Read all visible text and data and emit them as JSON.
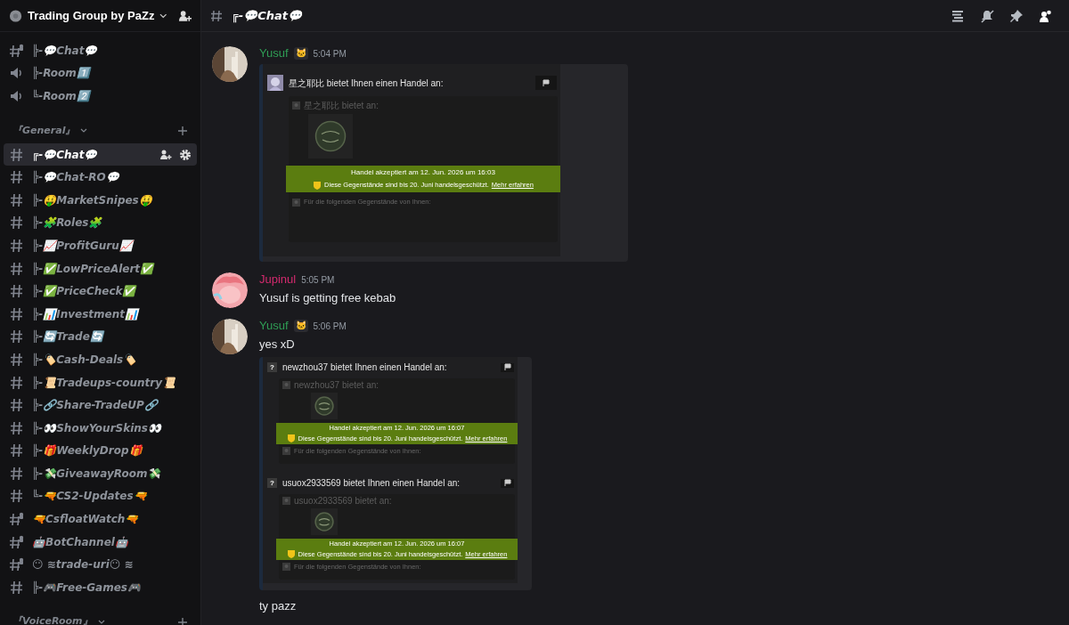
{
  "server": {
    "name": "Trading Group by PaZz"
  },
  "channels": [
    {
      "kind": "locked",
      "name": "╠-💬Chat💬",
      "selected": false
    },
    {
      "kind": "voice",
      "name": "╠-Room1️⃣",
      "selected": false
    },
    {
      "kind": "voice",
      "name": "╚-Room2️⃣",
      "selected": false
    }
  ],
  "categories": [
    {
      "name": "『General』",
      "channels": [
        {
          "kind": "text",
          "name": "╔-💬Chat💬",
          "selected": true
        },
        {
          "kind": "text",
          "name": "╠-💬Chat-RO💬",
          "selected": false
        },
        {
          "kind": "text",
          "name": "╠-🤑MarketSnipes🤑",
          "selected": false
        },
        {
          "kind": "text",
          "name": "╠-🧩Roles🧩",
          "selected": false
        },
        {
          "kind": "text",
          "name": "╠-📈ProfitGuru📈",
          "selected": false
        },
        {
          "kind": "text",
          "name": "╠-✅LowPriceAlert✅",
          "selected": false
        },
        {
          "kind": "text",
          "name": "╠-✅PriceCheck✅",
          "selected": false
        },
        {
          "kind": "text",
          "name": "╠-📊Investment📊",
          "selected": false
        },
        {
          "kind": "text",
          "name": "╠-🔄Trade🔄",
          "selected": false
        },
        {
          "kind": "text",
          "name": "╠-🏷️Cash-Deals🏷️",
          "selected": false
        },
        {
          "kind": "text",
          "name": "╠-📜Tradeups-country📜",
          "selected": false
        },
        {
          "kind": "text",
          "name": "╠-🔗Share-TradeUP🔗",
          "selected": false
        },
        {
          "kind": "text",
          "name": "╠-👀ShowYourSkins👀",
          "selected": false
        },
        {
          "kind": "text",
          "name": "╠-🎁WeeklyDrop🎁",
          "selected": false
        },
        {
          "kind": "text",
          "name": "╠-💸GiveawayRoom💸",
          "selected": false
        },
        {
          "kind": "text",
          "name": "╚-🔫CS2-Updates🔫",
          "selected": false
        },
        {
          "kind": "locked",
          "name": "🔫CsfloatWatch🔫",
          "selected": false
        },
        {
          "kind": "locked",
          "name": "🤖BotChannel🤖",
          "selected": false
        },
        {
          "kind": "locked",
          "name": "😶 ≋trade-uri😶 ≋",
          "selected": false
        },
        {
          "kind": "text",
          "name": "╠-🎮Free-Games🎮",
          "selected": false
        }
      ]
    },
    {
      "name": "『VoiceRoom』"
    }
  ],
  "header": {
    "channel": "╔-💬Chat💬"
  },
  "messages": [
    {
      "author": "Yusuf",
      "color": "#2f9e55",
      "badge": "🐱",
      "time": "5:04 PM",
      "attachment": {
        "trades": [
          {
            "title": "星之耶比 bietet Ihnen einen Handel an:",
            "offer": "星之耶比 bietet an:",
            "accepted": "Handel akzeptiert am 12. Jun. 2026 um 16:03",
            "protected": "Diese Gegenstände sind bis 20. Juni handelsgeschützt.",
            "link": "Mehr erfahren",
            "yours": "Für die folgenden Gegenstände von Ihnen:"
          }
        ]
      }
    },
    {
      "author": "Jupinul",
      "color": "#d42a6e",
      "time": "5:05 PM",
      "text": "Yusuf is getting free kebab"
    },
    {
      "author": "Yusuf",
      "color": "#2f9e55",
      "badge": "🐱",
      "time": "5:06 PM",
      "text": "yes xD",
      "attachment": {
        "trades": [
          {
            "avatar": {
              "kind": "unknown",
              "text": "?"
            },
            "title": "newzhou37 bietet Ihnen einen Handel an:",
            "offer": "newzhou37 bietet an:",
            "accepted": "Handel akzeptiert am 12. Jun. 2026 um 16:07",
            "protected": "Diese Gegenstände sind bis 20. Juni handelsgeschützt.",
            "link": "Mehr erfahren",
            "yours": "Für die folgenden Gegenstände von Ihnen:"
          },
          {
            "avatar": {
              "kind": "unknown",
              "text": "?"
            },
            "title": "usuox2933569 bietet Ihnen einen Handel an:",
            "offer": "usuox2933569 bietet an:",
            "accepted": "Handel akzeptiert am 12. Jun. 2026 um 16:07",
            "protected": "Diese Gegenstände sind bis 20. Juni handelsgeschützt.",
            "link": "Mehr erfahren",
            "yours": "Für die folgenden Gegenstände von Ihnen:"
          }
        ]
      },
      "after": "ty pazz"
    }
  ]
}
